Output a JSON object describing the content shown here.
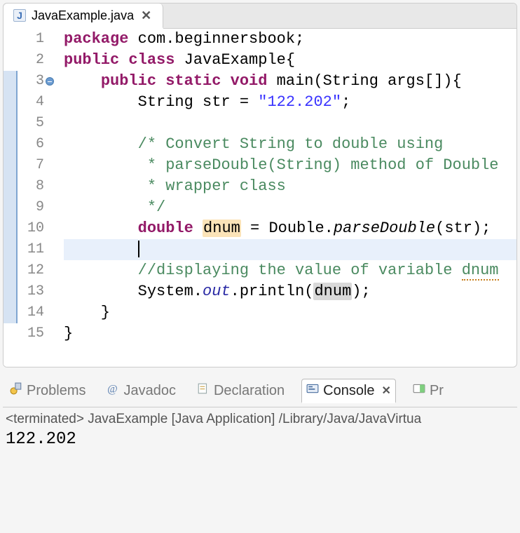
{
  "editorTab": {
    "icon": "J",
    "title": "JavaExample.java",
    "closeGlyph": "✕"
  },
  "code": {
    "lines": [
      {
        "n": 1,
        "hl": false,
        "tokens": [
          {
            "t": "kw",
            "v": "package"
          },
          {
            "t": "pl",
            "v": " com.beginnersbook;"
          }
        ]
      },
      {
        "n": 2,
        "hl": false,
        "tokens": [
          {
            "t": "kw",
            "v": "public"
          },
          {
            "t": "pl",
            "v": " "
          },
          {
            "t": "kw",
            "v": "class"
          },
          {
            "t": "pl",
            "v": " JavaExample{"
          }
        ]
      },
      {
        "n": 3,
        "hl": true,
        "fold": true,
        "tokens": [
          {
            "t": "pl",
            "v": "    "
          },
          {
            "t": "kw",
            "v": "public"
          },
          {
            "t": "pl",
            "v": " "
          },
          {
            "t": "kw",
            "v": "static"
          },
          {
            "t": "pl",
            "v": " "
          },
          {
            "t": "kw",
            "v": "void"
          },
          {
            "t": "pl",
            "v": " main(String args[]){"
          }
        ]
      },
      {
        "n": 4,
        "hl": true,
        "tokens": [
          {
            "t": "pl",
            "v": "        String str = "
          },
          {
            "t": "str",
            "v": "\"122.202\""
          },
          {
            "t": "pl",
            "v": ";"
          }
        ]
      },
      {
        "n": 5,
        "hl": true,
        "tokens": []
      },
      {
        "n": 6,
        "hl": true,
        "tokens": [
          {
            "t": "pl",
            "v": "        "
          },
          {
            "t": "cmt",
            "v": "/* Convert String to double using"
          }
        ]
      },
      {
        "n": 7,
        "hl": true,
        "tokens": [
          {
            "t": "pl",
            "v": "        "
          },
          {
            "t": "cmt",
            "v": " * parseDouble(String) method of Double"
          }
        ]
      },
      {
        "n": 8,
        "hl": true,
        "tokens": [
          {
            "t": "pl",
            "v": "        "
          },
          {
            "t": "cmt",
            "v": " * wrapper class"
          }
        ]
      },
      {
        "n": 9,
        "hl": true,
        "tokens": [
          {
            "t": "pl",
            "v": "        "
          },
          {
            "t": "cmt",
            "v": " */"
          }
        ]
      },
      {
        "n": 10,
        "hl": true,
        "tokens": [
          {
            "t": "pl",
            "v": "        "
          },
          {
            "t": "kw",
            "v": "double"
          },
          {
            "t": "pl",
            "v": " "
          },
          {
            "t": "identhl",
            "v": "dnum"
          },
          {
            "t": "pl",
            "v": " = Double."
          },
          {
            "t": "callit",
            "v": "parseDouble"
          },
          {
            "t": "pl",
            "v": "(str);"
          }
        ]
      },
      {
        "n": 11,
        "hl": true,
        "current": true,
        "cursor": true,
        "tokens": [
          {
            "t": "pl",
            "v": "        "
          }
        ]
      },
      {
        "n": 12,
        "hl": true,
        "tokens": [
          {
            "t": "pl",
            "v": "        "
          },
          {
            "t": "cmt",
            "v": "//displaying the value of variable "
          },
          {
            "t": "cmtsq",
            "v": "dnum"
          }
        ]
      },
      {
        "n": 13,
        "hl": true,
        "tokens": [
          {
            "t": "pl",
            "v": "        System."
          },
          {
            "t": "outit",
            "v": "out"
          },
          {
            "t": "pl",
            "v": ".println("
          },
          {
            "t": "identgrey",
            "v": "dnum"
          },
          {
            "t": "pl",
            "v": ");"
          }
        ]
      },
      {
        "n": 14,
        "hl": true,
        "tokens": [
          {
            "t": "pl",
            "v": "    }"
          }
        ]
      },
      {
        "n": 15,
        "hl": false,
        "tokens": [
          {
            "t": "pl",
            "v": "}"
          }
        ]
      }
    ]
  },
  "views": [
    {
      "name": "problems",
      "label": "Problems",
      "active": false
    },
    {
      "name": "javadoc",
      "label": "Javadoc",
      "active": false
    },
    {
      "name": "declaration",
      "label": "Declaration",
      "active": false
    },
    {
      "name": "console",
      "label": "Console",
      "active": true,
      "closeGlyph": "✕"
    },
    {
      "name": "progress",
      "label": "Pr",
      "active": false
    }
  ],
  "console": {
    "status": "<terminated> JavaExample [Java Application] /Library/Java/JavaVirtua",
    "output": "122.202"
  }
}
